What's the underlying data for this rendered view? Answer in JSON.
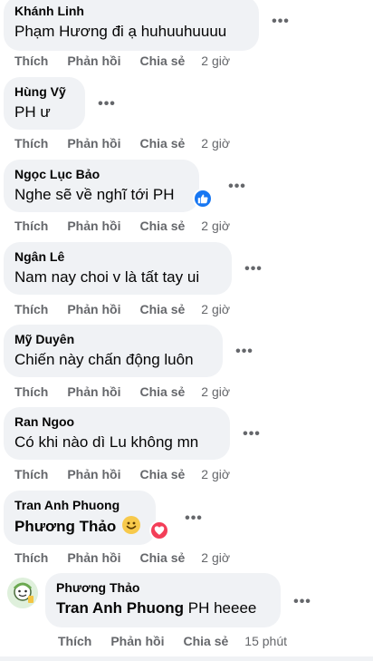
{
  "comments": [
    {
      "author": "Khánh Linh",
      "text": "Phạm Hương đi ạ huhuuhuuuu",
      "time": "2 giờ"
    },
    {
      "author": "Hùng Vỹ",
      "text": "PH ư",
      "time": "2 giờ"
    },
    {
      "author": "Ngọc Lục Bảo",
      "text": "Nghe sẽ về nghĩ tới PH",
      "time": "2 giờ",
      "reaction": "like"
    },
    {
      "author": "Ngân Lê",
      "text": "Nam nay choi v là tất tay ui",
      "time": "2 giờ"
    },
    {
      "author": "Mỹ Duyên",
      "text": "Chiến này chấn động luôn",
      "time": "2 giờ"
    },
    {
      "author": "Ran Ngoo",
      "text": "Có khi nào dì Lu không mn",
      "time": "2 giờ"
    },
    {
      "author": "Tran Anh Phuong",
      "mention": "Phương Thảo",
      "time": "2 giờ",
      "reaction": "love"
    }
  ],
  "reply": {
    "author": "Phương Thảo",
    "mention": "Tran Anh Phuong",
    "text": "PH heeee",
    "time": "15 phút"
  },
  "actions": {
    "like": "Thích",
    "reply": "Phản hồi",
    "share": "Chia sẻ"
  },
  "icons": {
    "more": "more-dots-icon",
    "like": "like-reaction-icon",
    "love": "love-reaction-icon",
    "smile": "smile-emoji-icon"
  },
  "colors": {
    "bubble": "#f0f2f5",
    "secondary_text": "#65676b",
    "like_blue": "#1877f2",
    "love_red": "#f33e58"
  }
}
